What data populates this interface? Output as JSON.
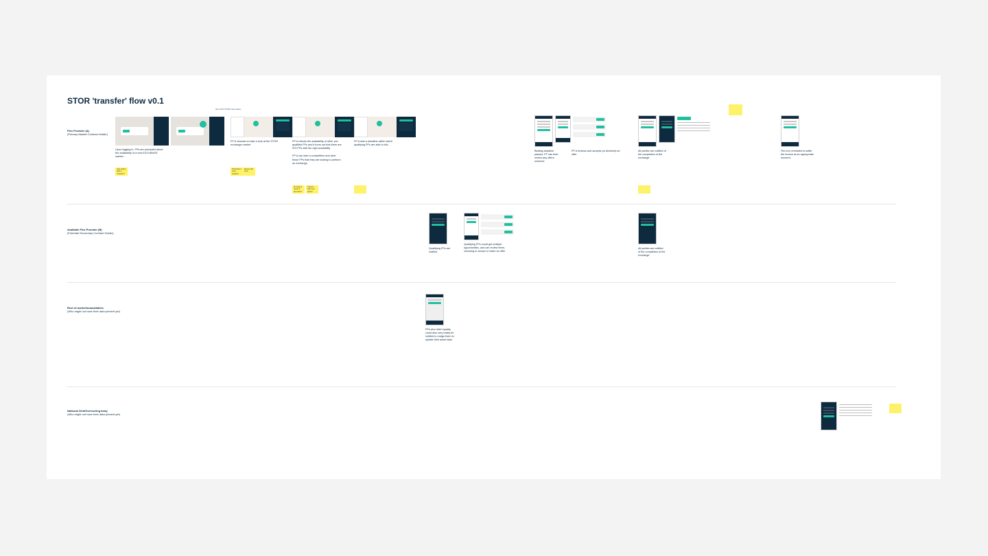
{
  "title": "STOR 'transfer' flow v0.1",
  "topLabel": "this is NOT STOR's new market...",
  "lanes": {
    "fpA": {
      "title": "Flex Provider (A)",
      "sub": "(Primary Market Contract Holder)"
    },
    "fpB": {
      "title": "Available Flex Provider (B)",
      "sub": "(Potential Secondary Contract Holder)"
    },
    "rest": {
      "title": "Rest of market/unavailables",
      "sub": "(Who might not have their data present yet)"
    },
    "ng": {
      "title": "National Grid/Overseeing body",
      "sub": "(Who might not have their data present yet)"
    }
  },
  "steps": {
    "a1": "Upon logging in, FPs are prompted about the availability of a new EXCHANGE market…",
    "a3": "FP A chooses to take a look at the STOR exchange market",
    "a4": "FP A checks the availability of other pre-qualified FPs and it turns out that there are 579 FPs with the right availability",
    "a4b": "FP A can start a competition and alert those FPs that they are looking to perform an exchange.",
    "a5": "FP A sets a deadline within which qualifying FPs are able to bid…",
    "a7": "Bidding deadline passes, FP can then review any offers received",
    "a7b": "FP A reviews and accepts (or declines) an offer",
    "a8": "All parties are notified of the completion of the exchange",
    "a9": "Flex A is reminded to settle the invoice at an appropriate moment.",
    "b6": "Qualifying FPs are notified",
    "b7": "Qualifying FPs could get multiple opportunities, and can review them, choosing to accept or make an offer",
    "b8": "All parties are notified of the completion of the exchange",
    "c6": "FPs who didn't qualify could also very easily be notified to nudge them to update their asset data"
  },
  "stickies": {
    "s1": "only writes with a contract?",
    "s3a": "Production view needed",
    "s3b": "Reuse tab view",
    "s4a": "do buyers need to see who?",
    "s4b": "Version with sort option",
    "s5": "…",
    "s8": "…",
    "stop": "…",
    "sng": "…"
  }
}
